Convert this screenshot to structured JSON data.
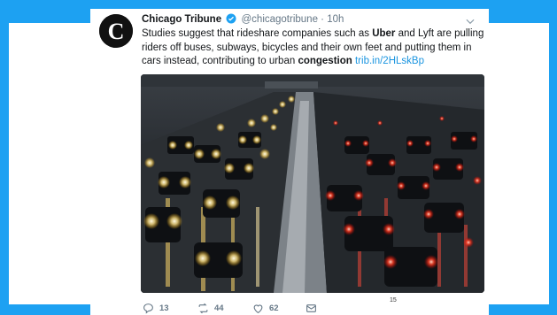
{
  "tweet": {
    "display_name": "Chicago Tribune",
    "handle": "@chicagotribune",
    "separator": " · ",
    "time": "10h",
    "text_parts": {
      "p1": "Studies suggest that rideshare companies such as ",
      "p2": "Uber",
      "p3": " and Lyft are pulling riders off buses, subways, bicycles and their own feet and putting them in cars instead, contributing to urban ",
      "p4": "congestion",
      "p5": " ",
      "link": "trib.in/2HLskBp"
    },
    "media_description_icon": "traffic-photo"
  },
  "actions": {
    "reply_count": "13",
    "retweet_count": "44",
    "like_count": "62"
  },
  "page_number": "15",
  "colors": {
    "accent": "#1da1f2",
    "link": "#1b95e0",
    "verified": "#1da1f2",
    "text": "#14171a",
    "muted": "#657786"
  }
}
